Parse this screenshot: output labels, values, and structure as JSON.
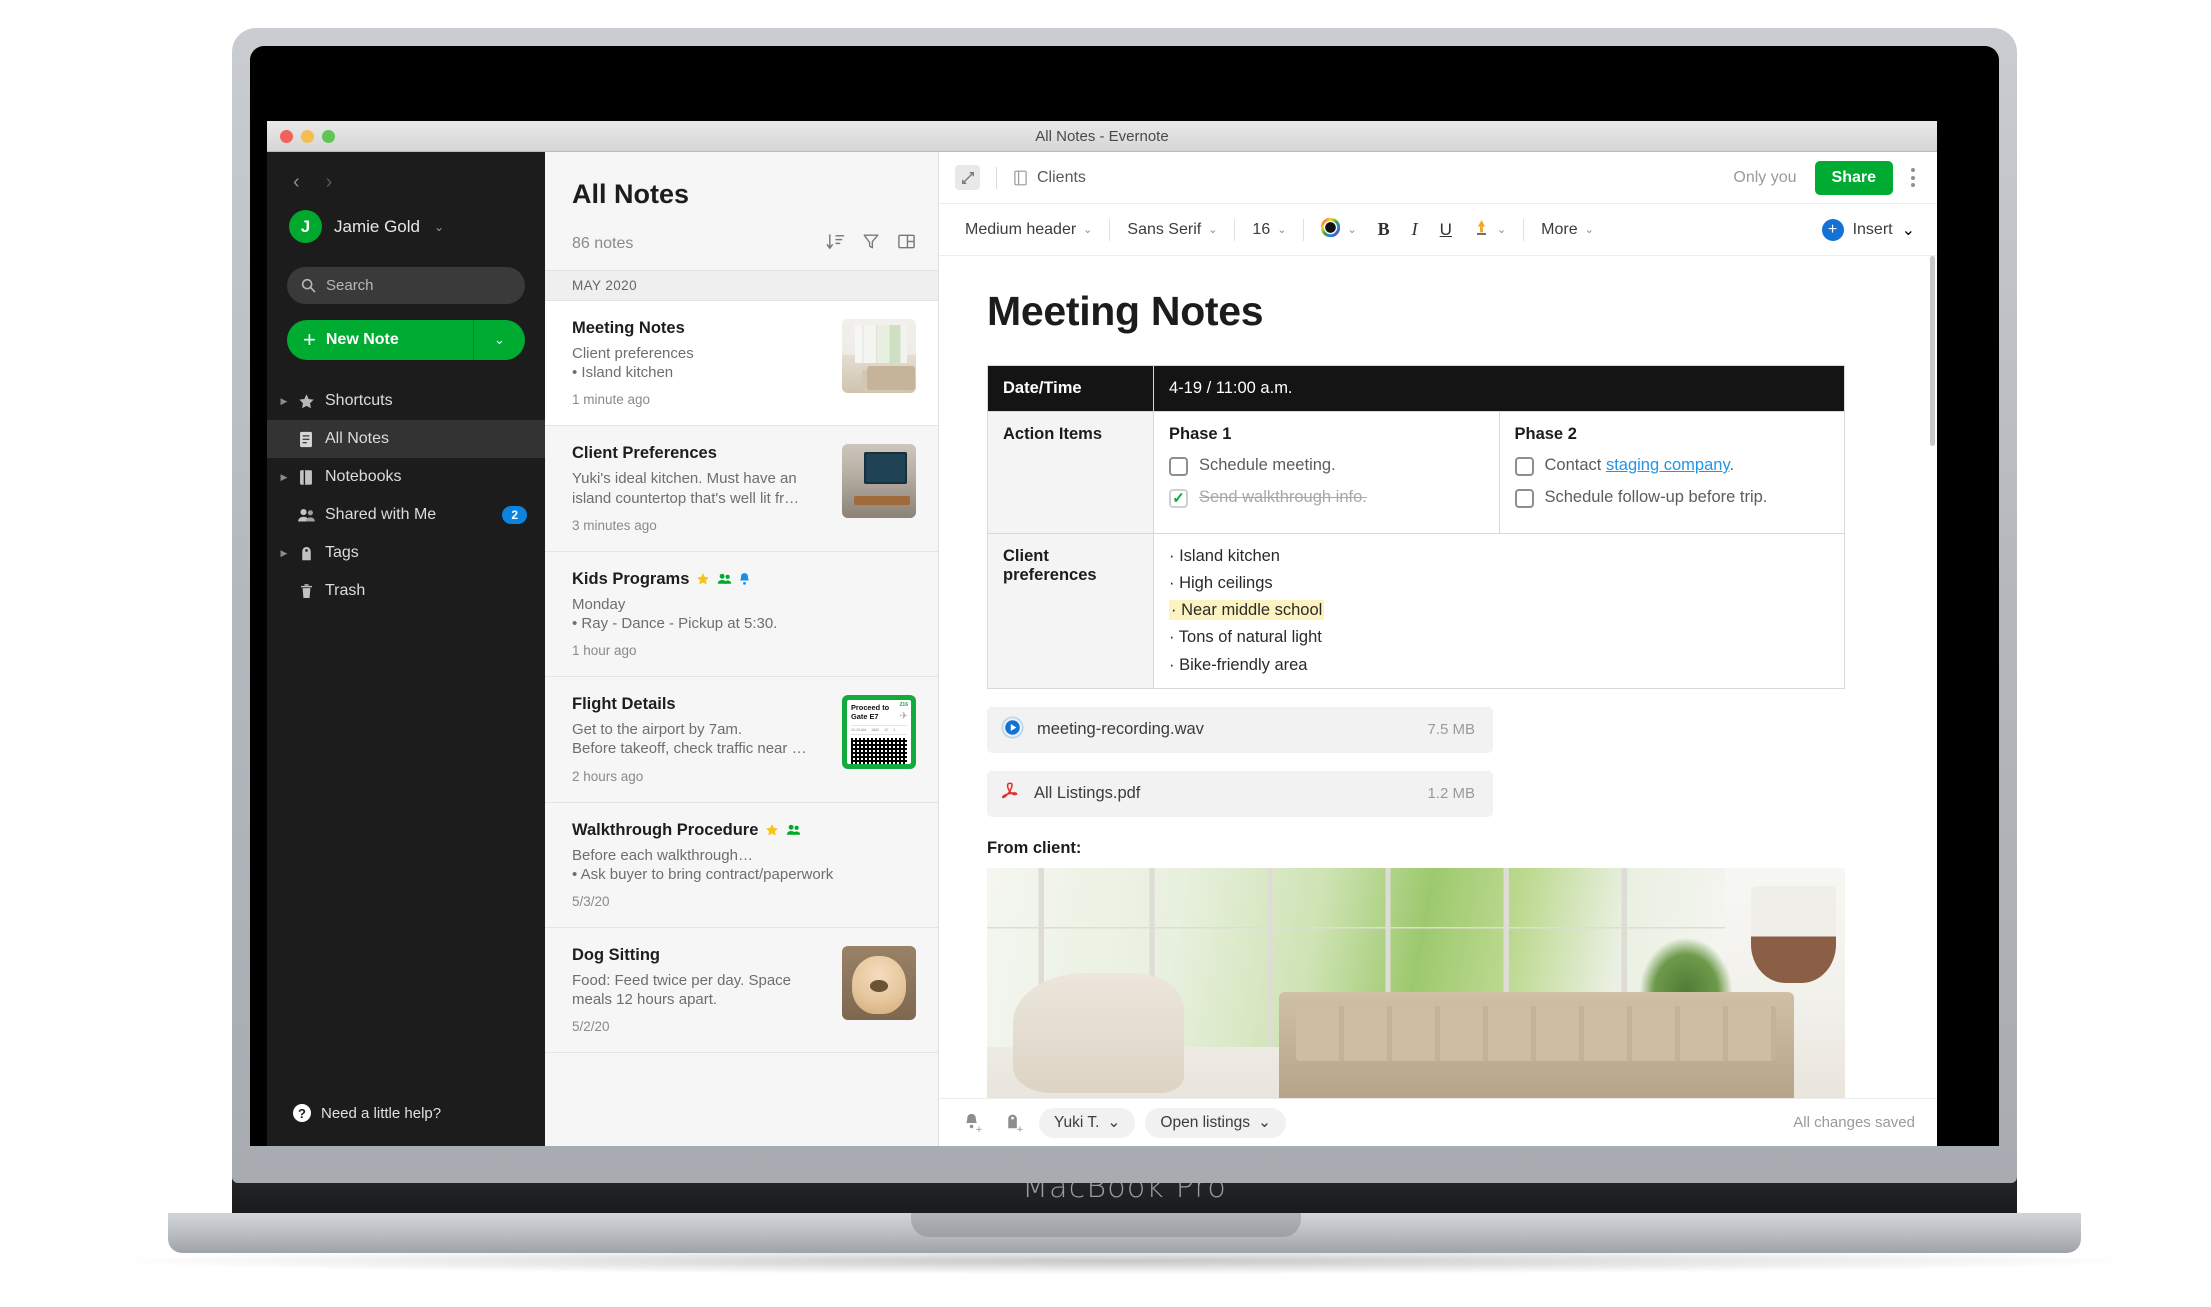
{
  "device": {
    "brand_label": "MacBook Pro"
  },
  "window": {
    "title": "All Notes - Evernote"
  },
  "sidebar": {
    "back_icon": "chevron-left-icon",
    "forward_icon": "chevron-right-icon",
    "account": {
      "initial": "J",
      "name": "Jamie Gold",
      "caret": "⌄"
    },
    "search": {
      "placeholder": "Search",
      "icon": "search-icon"
    },
    "new_note": {
      "label": "New Note",
      "plus": "+",
      "caret": "⌄"
    },
    "items": [
      {
        "label": "Shortcuts",
        "icon": "star-icon",
        "expandable": true,
        "active": false,
        "badge": ""
      },
      {
        "label": "All Notes",
        "icon": "notes-icon",
        "expandable": false,
        "active": true,
        "badge": ""
      },
      {
        "label": "Notebooks",
        "icon": "notebook-icon",
        "expandable": true,
        "active": false,
        "badge": ""
      },
      {
        "label": "Shared with Me",
        "icon": "people-icon",
        "expandable": false,
        "active": false,
        "badge": "2"
      },
      {
        "label": "Tags",
        "icon": "tag-icon",
        "expandable": true,
        "active": false,
        "badge": ""
      },
      {
        "label": "Trash",
        "icon": "trash-icon",
        "expandable": false,
        "active": false,
        "badge": ""
      }
    ],
    "help": {
      "label": "Need a little help?",
      "icon": "question-mark-icon"
    },
    "badge_color": "#0a84e0",
    "accent_color": "#00ab32"
  },
  "notelist": {
    "title": "All Notes",
    "count": "86 notes",
    "icons": [
      "sort-icon",
      "filter-icon",
      "layout-icon"
    ],
    "section_header": "MAY 2020",
    "notes": [
      {
        "title": "Meeting Notes",
        "snippet_line1": "Client preferences",
        "snippet_line2": "• Island kitchen",
        "date": "1 minute ago",
        "selected": true,
        "thumb": "living-room-thumb",
        "pins": []
      },
      {
        "title": "Client Preferences",
        "snippet_line1": "Yuki's ideal kitchen. Must have an",
        "snippet_line2": "island countertop that's well lit fr…",
        "date": "3 minutes ago",
        "selected": false,
        "thumb": "kitchen-thumb",
        "pins": []
      },
      {
        "title": "Kids Programs",
        "snippet_line1": "Monday",
        "snippet_line2": "• Ray - Dance - Pickup at 5:30.",
        "date": "1 hour ago",
        "selected": false,
        "thumb": "",
        "pins": [
          "star-icon",
          "shared-icon",
          "reminder-bell-icon"
        ]
      },
      {
        "title": "Flight Details",
        "snippet_line1": "Get to the airport by 7am.",
        "snippet_line2": "Before takeoff, check traffic near …",
        "date": "2 hours ago",
        "selected": false,
        "thumb": "boarding-pass-thumb",
        "pins": []
      },
      {
        "title": "Walkthrough Procedure",
        "snippet_line1": "Before each walkthrough…",
        "snippet_line2": "•  Ask buyer to bring contract/paperwork",
        "date": "5/3/20",
        "selected": false,
        "thumb": "",
        "pins": [
          "star-icon",
          "shared-icon"
        ]
      },
      {
        "title": "Dog Sitting",
        "snippet_line1": "Food: Feed twice per day. Space",
        "snippet_line2": "meals 12 hours apart.",
        "date": "5/2/20",
        "selected": false,
        "thumb": "dog-thumb",
        "pins": []
      }
    ],
    "boarding_pass": {
      "headline_line1": "Proceed to",
      "headline_line2": "Gate E7",
      "flight_number": "216",
      "strip": [
        "10:15 AM",
        "1882",
        "12",
        "1"
      ]
    }
  },
  "editor": {
    "expand_icon": "expand-collapse-icon",
    "notebook": {
      "name": "Clients",
      "icon": "notebook-icon"
    },
    "only_you": "Only you",
    "share_label": "Share",
    "more_icon": "kebab-menu-icon",
    "format_bar": {
      "style": "Medium header",
      "font": "Sans Serif",
      "size": "16",
      "color_icon": "color-wheel-icon",
      "bold": "B",
      "italic": "I",
      "underline": "U",
      "highlight_icon": "highlighter-icon",
      "more": "More",
      "caret": "⌄"
    },
    "insert": {
      "label": "Insert",
      "plus": "+",
      "caret": "⌄"
    },
    "note": {
      "title": "Meeting Notes",
      "table": {
        "datetime_label": "Date/Time",
        "datetime_value": "4-19 / 11:00 a.m.",
        "action_items_label": "Action Items",
        "phase1": {
          "title": "Phase 1",
          "items": [
            {
              "text": "Schedule meeting.",
              "checked": false
            },
            {
              "text": "Send walkthrough info.",
              "checked": true
            }
          ]
        },
        "phase2": {
          "title": "Phase 2",
          "items": [
            {
              "text": "Contact ",
              "link": "staging company",
              "text_after": ".",
              "checked": false
            },
            {
              "text": "Schedule follow-up before trip.",
              "checked": false
            }
          ]
        },
        "client_pref_label_line1": "Client",
        "client_pref_label_line2": "preferences",
        "client_preferences": [
          {
            "text": "Island kitchen",
            "highlighted": false
          },
          {
            "text": "High ceilings",
            "highlighted": false
          },
          {
            "text": "Near middle school",
            "highlighted": true
          },
          {
            "text": "Tons of natural light",
            "highlighted": false
          },
          {
            "text": "Bike-friendly area",
            "highlighted": false
          }
        ]
      },
      "attachments": [
        {
          "name": "meeting-recording.wav",
          "size": "7.5 MB",
          "icon": "audio-play-icon"
        },
        {
          "name": "All Listings.pdf",
          "size": "1.2 MB",
          "icon": "pdf-icon"
        }
      ],
      "from_client_label": "From client:",
      "hero_image": "living-room-photo"
    },
    "footer": {
      "add_reminder_icon": "add-reminder-icon",
      "add_tag_icon": "add-tag-icon",
      "author_chip": "Yuki T.",
      "notebook_chip": "Open listings",
      "caret": "⌄",
      "save_status": "All changes saved"
    },
    "accent_color": "#00ab32",
    "link_color": "#2196e3",
    "highlight_color": "#fcf3c0"
  }
}
